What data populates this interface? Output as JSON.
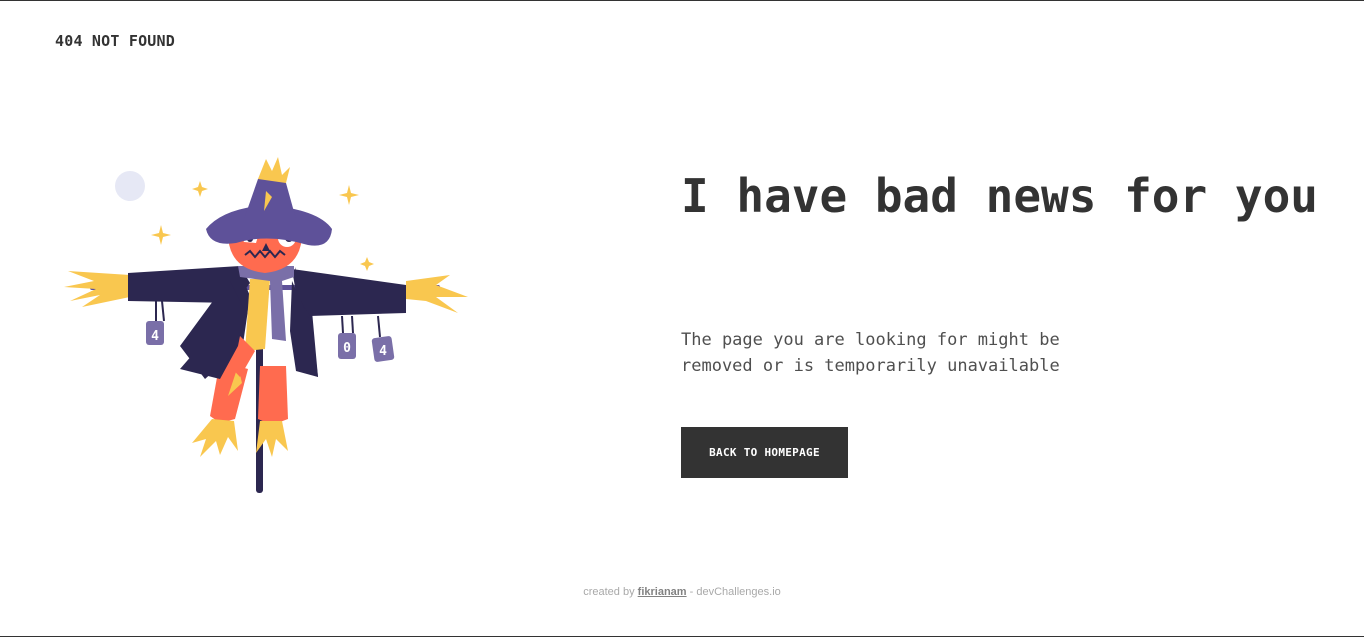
{
  "header": {
    "brand": "404 NOT FOUND"
  },
  "illustration": {
    "can_left": "4",
    "can_mid": "0",
    "can_right": "4"
  },
  "main": {
    "headline": "I have bad news for you",
    "description": "The page you are looking for might be removed or is temporarily unavailable",
    "cta_label": "BACK TO HOMEPAGE"
  },
  "footer": {
    "prefix": "created by",
    "author": "fikrianam",
    "suffix": "- devChallenges.io"
  },
  "colors": {
    "text": "#333333",
    "button_bg": "#333333",
    "hat": "#5E5199",
    "coat": "#2C2750",
    "face": "#FF6B4F",
    "straw": "#F9C74F",
    "cans": "#7A6FA8"
  }
}
